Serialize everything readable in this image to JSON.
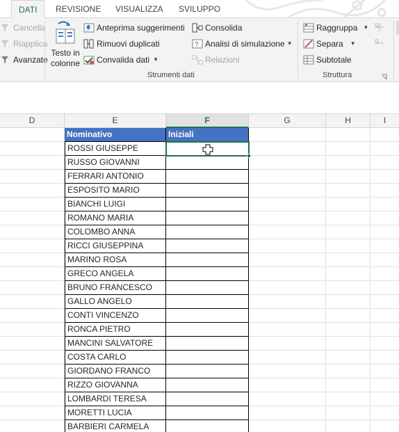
{
  "ribbon_tabs": {
    "dati": "DATI",
    "revisione": "REVISIONE",
    "visualizza": "VISUALIZZA",
    "sviluppo": "SVILUPPO"
  },
  "ribbon": {
    "cancella": "Cancella",
    "riapplica": "Riapplica",
    "avanzate": "Avanzate",
    "testo_in_colonne_1": "Testo in",
    "testo_in_colonne_2": "colonne",
    "anteprima_suggerimenti": "Anteprima suggerimenti",
    "rimuovi_duplicati": "Rimuovi duplicati",
    "convalida_dati": "Convalida dati",
    "consolida": "Consolida",
    "analisi_simulazione": "Analisi di simulazione",
    "relazioni": "Relazioni",
    "group_strumenti_dati": "Strumenti dati",
    "raggruppa": "Raggruppa",
    "separa": "Separa",
    "subtotale": "Subtotale",
    "group_struttura": "Struttura"
  },
  "columns": [
    "D",
    "E",
    "F",
    "G",
    "H",
    "I"
  ],
  "table": {
    "header_nominativo": "Nominativo",
    "header_iniziali": "Iniziali",
    "names": [
      "ROSSI GIUSEPPE",
      "RUSSO GIOVANNI",
      "FERRARI ANTONIO",
      "ESPOSITO MARIO",
      "BIANCHI LUIGI",
      "ROMANO MARIA",
      "COLOMBO ANNA",
      "RICCI GIUSEPPINA",
      "MARINO ROSA",
      "GRECO ANGELA",
      "BRUNO FRANCESCO",
      "GALLO ANGELO",
      "CONTI VINCENZO",
      "RONCA PIETRO",
      "MANCINI SALVATORE",
      "COSTA CARLO",
      "GIORDANO FRANCO",
      "RIZZO GIOVANNA",
      "LOMBARDI TERESA",
      "MORETTI LUCIA",
      "BARBIERI CARMELA"
    ]
  },
  "colors": {
    "accent_green": "#217346",
    "header_blue": "#4472c4"
  }
}
